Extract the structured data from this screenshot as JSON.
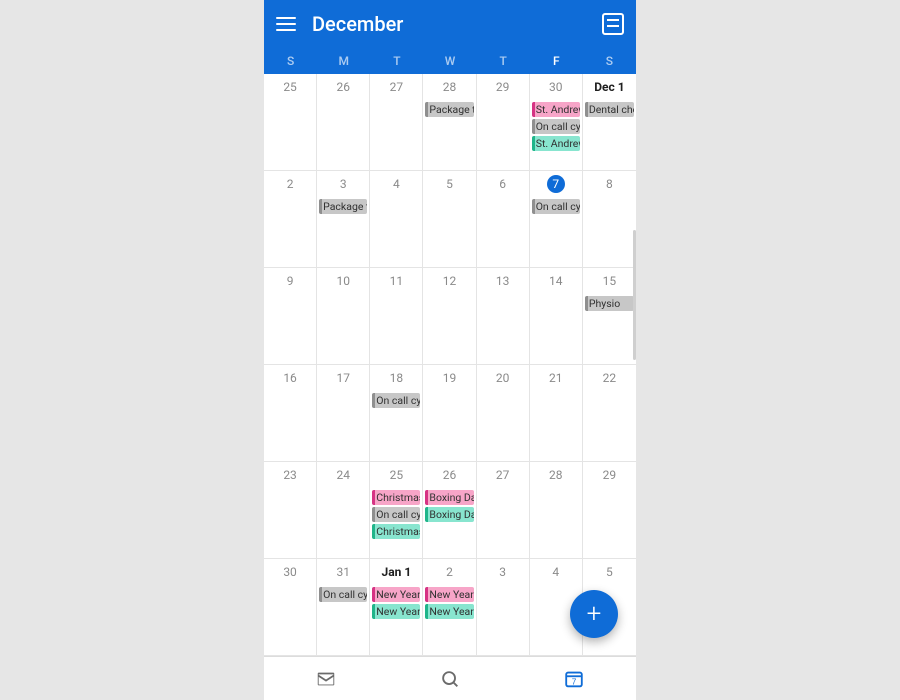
{
  "header": {
    "title": "December"
  },
  "dow": [
    "S",
    "M",
    "T",
    "W",
    "T",
    "F",
    "S"
  ],
  "today_column_index": 5,
  "weeks": [
    {
      "days": [
        {
          "num": "25"
        },
        {
          "num": "26"
        },
        {
          "num": "27"
        },
        {
          "num": "28",
          "events": [
            {
              "label": "Package t",
              "color": "grey"
            }
          ]
        },
        {
          "num": "29"
        },
        {
          "num": "30",
          "events": [
            {
              "label": "St. Andrew",
              "color": "pink"
            },
            {
              "label": "On call cy",
              "color": "grey"
            },
            {
              "label": "St. Andrew",
              "color": "teal"
            }
          ]
        },
        {
          "num": "Dec 1",
          "bold": true,
          "events": [
            {
              "label": "Dental che",
              "color": "grey"
            }
          ]
        }
      ]
    },
    {
      "days": [
        {
          "num": "2"
        },
        {
          "num": "3",
          "events": [
            {
              "label": "Package t",
              "color": "grey"
            }
          ]
        },
        {
          "num": "4"
        },
        {
          "num": "5"
        },
        {
          "num": "6"
        },
        {
          "num": "7",
          "today": true,
          "events": [
            {
              "label": "On call cy",
              "color": "grey"
            }
          ]
        },
        {
          "num": "8"
        }
      ]
    },
    {
      "days": [
        {
          "num": "9"
        },
        {
          "num": "10"
        },
        {
          "num": "11"
        },
        {
          "num": "12"
        },
        {
          "num": "13"
        },
        {
          "num": "14"
        },
        {
          "num": "15",
          "events": [
            {
              "label": "Physio",
              "color": "grey"
            }
          ]
        }
      ]
    },
    {
      "days": [
        {
          "num": "16"
        },
        {
          "num": "17"
        },
        {
          "num": "18",
          "events": [
            {
              "label": "On call cy",
              "color": "grey"
            }
          ]
        },
        {
          "num": "19"
        },
        {
          "num": "20"
        },
        {
          "num": "21"
        },
        {
          "num": "22"
        }
      ]
    },
    {
      "days": [
        {
          "num": "23"
        },
        {
          "num": "24"
        },
        {
          "num": "25",
          "events": [
            {
              "label": "Christmas",
              "color": "pink"
            },
            {
              "label": "On call cy",
              "color": "grey"
            },
            {
              "label": "Christmas",
              "color": "teal"
            }
          ]
        },
        {
          "num": "26",
          "events": [
            {
              "label": "Boxing Da",
              "color": "pink"
            },
            {
              "label": "Boxing Da",
              "color": "teal"
            }
          ]
        },
        {
          "num": "27"
        },
        {
          "num": "28"
        },
        {
          "num": "29"
        }
      ]
    },
    {
      "days": [
        {
          "num": "30"
        },
        {
          "num": "31",
          "events": [
            {
              "label": "On call cy",
              "color": "grey"
            }
          ]
        },
        {
          "num": "Jan 1",
          "bold": true,
          "events": [
            {
              "label": "New Year",
              "color": "pink"
            },
            {
              "label": "New Year",
              "color": "teal"
            }
          ]
        },
        {
          "num": "2",
          "events": [
            {
              "label": "New Year",
              "color": "pink"
            },
            {
              "label": "New Year",
              "color": "teal"
            }
          ]
        },
        {
          "num": "3"
        },
        {
          "num": "4"
        },
        {
          "num": "5"
        }
      ]
    }
  ],
  "bottom_nav": {
    "mail": "mail-icon",
    "search": "search-icon",
    "calendar": "calendar-icon",
    "calendar_day": "7"
  }
}
